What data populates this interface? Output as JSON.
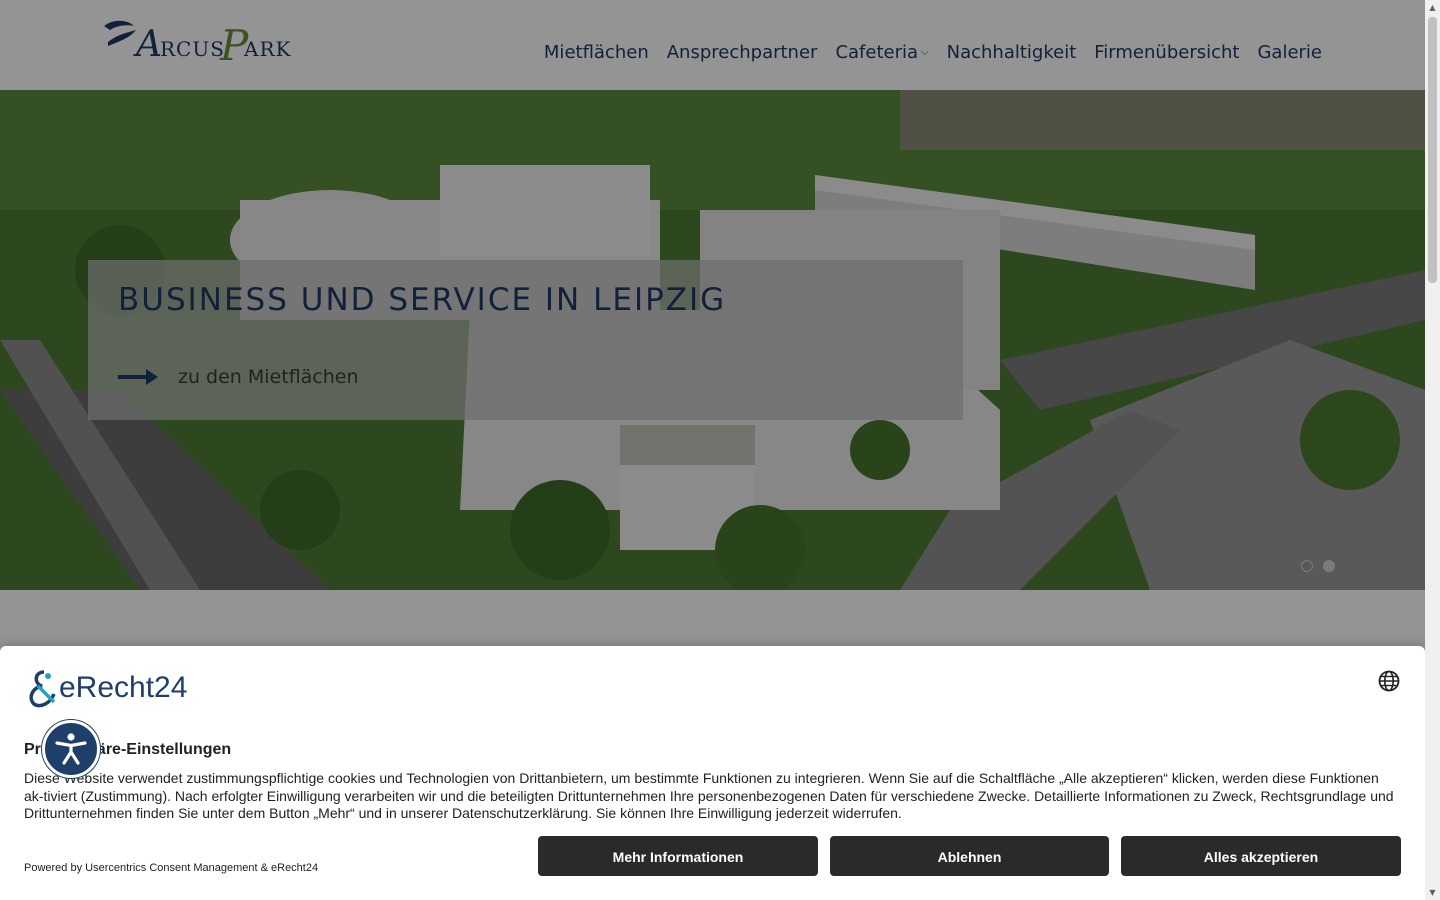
{
  "header": {
    "logo_text": "ArcusPark",
    "nav": [
      {
        "label": "Mietflächen"
      },
      {
        "label": "Ansprechpartner"
      },
      {
        "label": "Cafeteria",
        "has_dropdown": true
      },
      {
        "label": "Nachhaltigkeit"
      },
      {
        "label": "Firmenübersicht"
      },
      {
        "label": "Galerie"
      }
    ]
  },
  "hero": {
    "title": "BUSINESS UND SERVICE IN LEIPZIG",
    "link_label": "zu den Mietflächen",
    "slides": 2,
    "active_slide": 1
  },
  "consent": {
    "brand": "eRecht24",
    "title": "Privatsphäre-Einstellungen",
    "text": "Diese Website verwendet zustimmungspflichtige cookies und Technologien von Drittanbietern, um bestimmte Funktionen zu integrieren. Wenn Sie auf die Schaltfläche „Alle akzeptieren“ klicken, werden diese Funktionen ak-tiviert (Zustimmung). Nach erfolgter Einwilligung verarbeiten wir und die beteiligten Drittunternehmen Ihre personenbezogenen Daten für verschiedene Zwecke. Detaillierte Informationen zu Zweck, Rechtsgrundlage und Drittunternehmen finden Sie unter dem Button „Mehr“ und in unserer Datenschutzerklärung. Sie können Ihre Einwilligung jederzeit widerrufen.",
    "powered_by": "Powered by Usercentrics Consent Management & eRecht24",
    "buttons": {
      "more": "Mehr Informationen",
      "decline": "Ablehnen",
      "accept": "Alles akzeptieren"
    }
  },
  "colors": {
    "brand_navy": "#1f3a66",
    "logo_green": "#6b8e3a",
    "button_dark": "#2a2a2a"
  },
  "icons": {
    "language": "globe-icon",
    "accessibility": "accessibility-icon",
    "hero_link": "arrow-right-icon"
  }
}
